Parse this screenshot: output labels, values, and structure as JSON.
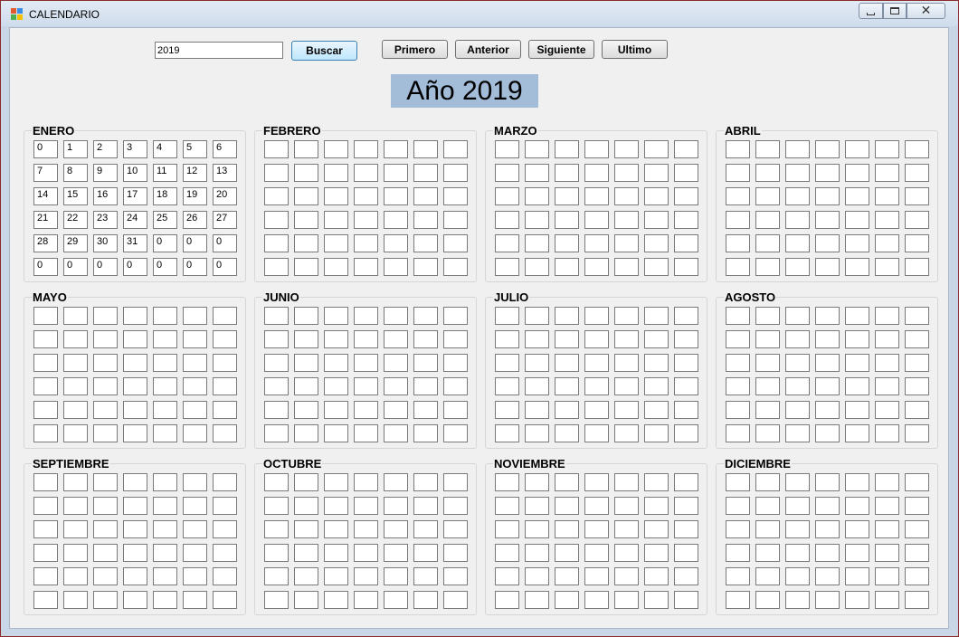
{
  "window": {
    "title": "CALENDARIO",
    "icons": {
      "app": "app-window-icon",
      "minimize": "minimize-icon",
      "maximize": "maximize-icon",
      "close": "close-icon"
    },
    "close_glyph": "✕"
  },
  "toolbar": {
    "year_value": "2019",
    "buscar_label": "Buscar",
    "primero_label": "Primero",
    "anterior_label": "Anterior",
    "siguiente_label": "Siguiente",
    "ultimo_label": "Ultimo"
  },
  "year_title": "Año 2019",
  "months": [
    {
      "name": "ENERO",
      "days": [
        [
          "0",
          "1",
          "2",
          "3",
          "4",
          "5",
          "6"
        ],
        [
          "7",
          "8",
          "9",
          "10",
          "11",
          "12",
          "13"
        ],
        [
          "14",
          "15",
          "16",
          "17",
          "18",
          "19",
          "20"
        ],
        [
          "21",
          "22",
          "23",
          "24",
          "25",
          "26",
          "27"
        ],
        [
          "28",
          "29",
          "30",
          "31",
          "0",
          "0",
          "0"
        ],
        [
          "0",
          "0",
          "0",
          "0",
          "0",
          "0",
          "0"
        ]
      ]
    },
    {
      "name": "FEBRERO",
      "days": []
    },
    {
      "name": "MARZO",
      "days": []
    },
    {
      "name": "ABRIL",
      "days": []
    },
    {
      "name": "MAYO",
      "days": []
    },
    {
      "name": "JUNIO",
      "days": []
    },
    {
      "name": "JULIO",
      "days": []
    },
    {
      "name": "AGOSTO",
      "days": []
    },
    {
      "name": "SEPTIEMBRE",
      "days": []
    },
    {
      "name": "OCTUBRE",
      "days": []
    },
    {
      "name": "NOVIEMBRE",
      "days": []
    },
    {
      "name": "DICIEMBRE",
      "days": []
    }
  ]
}
